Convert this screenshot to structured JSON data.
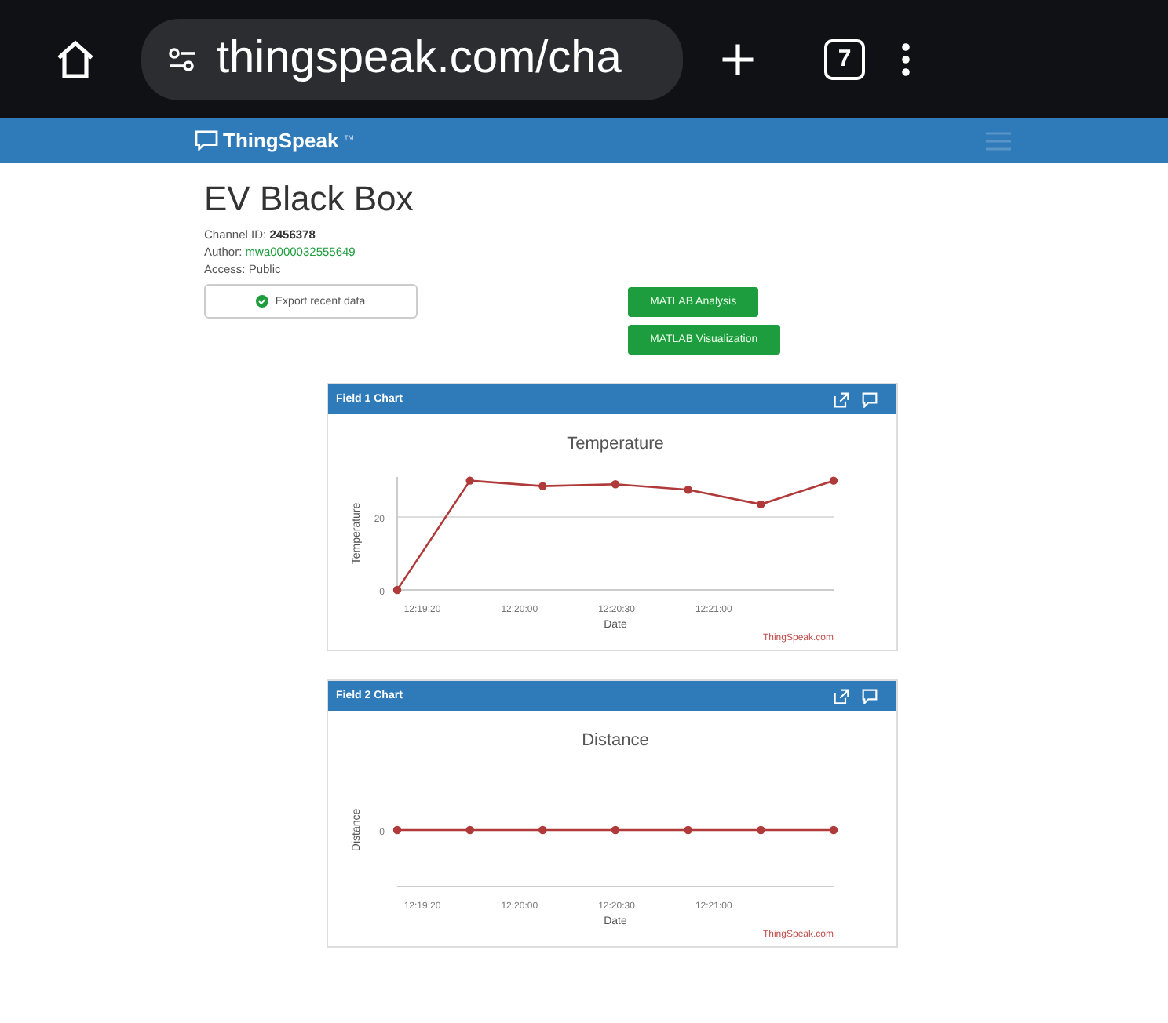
{
  "browser": {
    "url": "thingspeak.com/cha",
    "tab_count": "7"
  },
  "navbar": {
    "brand": "ThingSpeak",
    "trademark": "™"
  },
  "channel": {
    "title": "EV Black Box",
    "id_label": "Channel ID:",
    "id": "2456378",
    "author_label": "Author:",
    "author": "mwa0000032555649",
    "access": "Access: Public"
  },
  "buttons": {
    "export": "Export recent data",
    "analysis": "MATLAB Analysis",
    "visualization": "MATLAB Visualization"
  },
  "charts": [
    {
      "header": "Field 1 Chart",
      "credit": "ThingSpeak.com",
      "x_tick_labels": [
        "12:19:20",
        "12:20:00",
        "12:20:30",
        "12:21:00"
      ],
      "chart_data": {
        "type": "line",
        "title": "Temperature",
        "xlabel": "Date",
        "ylabel": "Temperature",
        "categories": [
          null,
          null,
          null,
          null,
          null,
          null,
          null
        ],
        "ylim": [
          0,
          31
        ],
        "yticks": [
          0,
          20
        ],
        "series": [
          {
            "color": "#b03a3a",
            "marker": "circle",
            "values": [
              0,
              30,
              28.5,
              29,
              27.5,
              23.5,
              30
            ]
          }
        ]
      }
    },
    {
      "header": "Field 2 Chart",
      "credit": "ThingSpeak.com",
      "x_tick_labels": [
        "12:19:20",
        "12:20:00",
        "12:20:30",
        "12:21:00"
      ],
      "y_tick_label": "0",
      "title": "Distance",
      "xlabel": "Date",
      "ylabel": "Distance"
    }
  ]
}
